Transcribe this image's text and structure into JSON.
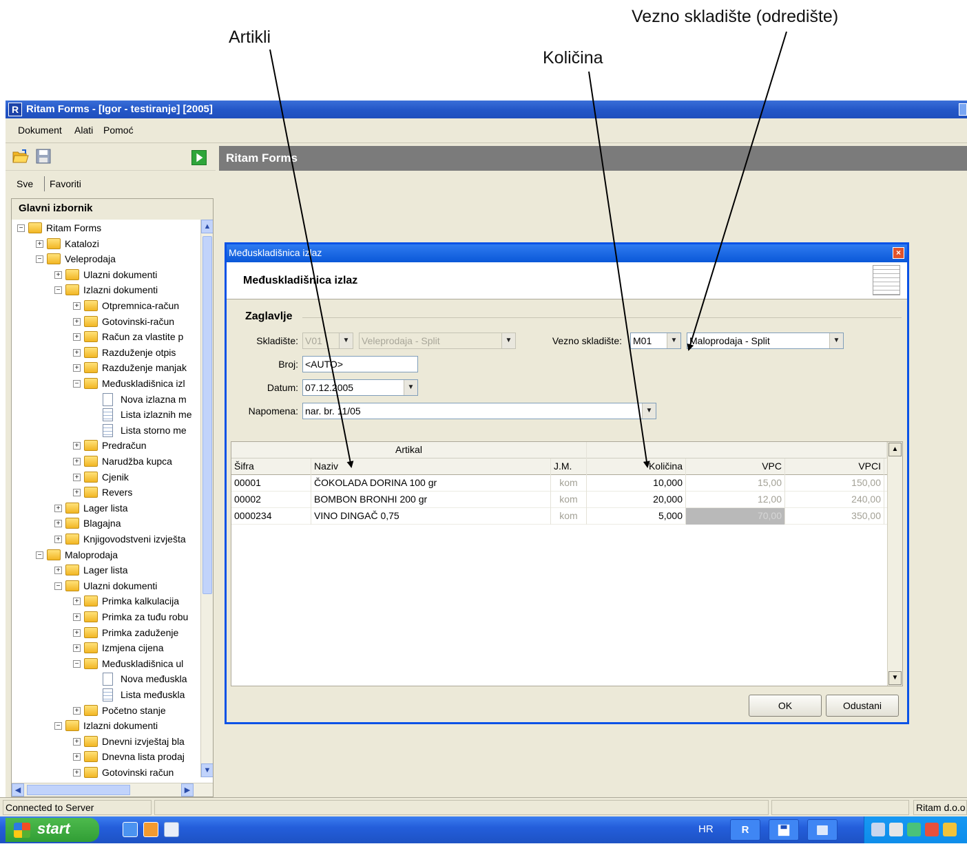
{
  "annotations": {
    "artikli": "Artikli",
    "kolicina": "Količina",
    "vezno": "Vezno skladište (odredište)"
  },
  "window": {
    "title": "Ritam Forms - [Igor - testiranje] [2005]",
    "logo_letter": "R"
  },
  "menu": [
    "Dokument",
    "Alati",
    "Pomoć"
  ],
  "left_panel": {
    "tabs": [
      "Sve",
      "Favoriti"
    ],
    "tree_title": "Glavni izbornik",
    "tree": [
      {
        "label": "Ritam Forms",
        "level": 0,
        "expander": "−",
        "icon": "folder"
      },
      {
        "label": "Katalozi",
        "level": 1,
        "expander": "+",
        "icon": "folder"
      },
      {
        "label": "Veleprodaja",
        "level": 1,
        "expander": "−",
        "icon": "folder"
      },
      {
        "label": "Ulazni dokumenti",
        "level": 2,
        "expander": "+",
        "icon": "folder"
      },
      {
        "label": "Izlazni dokumenti",
        "level": 2,
        "expander": "−",
        "icon": "folder"
      },
      {
        "label": "Otpremnica-račun",
        "level": 3,
        "expander": "+",
        "icon": "folder"
      },
      {
        "label": "Gotovinski-račun",
        "level": 3,
        "expander": "+",
        "icon": "folder"
      },
      {
        "label": "Račun za vlastite p",
        "level": 3,
        "expander": "+",
        "icon": "folder"
      },
      {
        "label": "Razduženje otpis",
        "level": 3,
        "expander": "+",
        "icon": "folder"
      },
      {
        "label": "Razduženje manjak",
        "level": 3,
        "expander": "+",
        "icon": "folder"
      },
      {
        "label": "Međuskladišnica izl",
        "level": 3,
        "expander": "−",
        "icon": "folder"
      },
      {
        "label": "Nova izlazna m",
        "level": 4,
        "expander": "",
        "icon": "doc"
      },
      {
        "label": "Lista izlaznih me",
        "level": 4,
        "expander": "",
        "icon": "doc-lines"
      },
      {
        "label": "Lista storno me",
        "level": 4,
        "expander": "",
        "icon": "doc-lines"
      },
      {
        "label": "Predračun",
        "level": 3,
        "expander": "+",
        "icon": "folder"
      },
      {
        "label": "Narudžba kupca",
        "level": 3,
        "expander": "+",
        "icon": "folder"
      },
      {
        "label": "Cjenik",
        "level": 3,
        "expander": "+",
        "icon": "folder"
      },
      {
        "label": "Revers",
        "level": 3,
        "expander": "+",
        "icon": "folder"
      },
      {
        "label": "Lager lista",
        "level": 2,
        "expander": "+",
        "icon": "folder"
      },
      {
        "label": "Blagajna",
        "level": 2,
        "expander": "+",
        "icon": "folder"
      },
      {
        "label": "Knjigovodstveni izvješta",
        "level": 2,
        "expander": "+",
        "icon": "folder"
      },
      {
        "label": "Maloprodaja",
        "level": 1,
        "expander": "−",
        "icon": "folder"
      },
      {
        "label": "Lager lista",
        "level": 2,
        "expander": "+",
        "icon": "folder"
      },
      {
        "label": "Ulazni dokumenti",
        "level": 2,
        "expander": "−",
        "icon": "folder"
      },
      {
        "label": "Primka kalkulacija",
        "level": 3,
        "expander": "+",
        "icon": "folder"
      },
      {
        "label": "Primka za tuđu robu",
        "level": 3,
        "expander": "+",
        "icon": "folder"
      },
      {
        "label": "Primka zaduženje",
        "level": 3,
        "expander": "+",
        "icon": "folder"
      },
      {
        "label": "Izmjena cijena",
        "level": 3,
        "expander": "+",
        "icon": "folder"
      },
      {
        "label": "Međuskladišnica ul",
        "level": 3,
        "expander": "−",
        "icon": "folder"
      },
      {
        "label": "Nova međuskla",
        "level": 4,
        "expander": "",
        "icon": "doc"
      },
      {
        "label": "Lista međuskla",
        "level": 4,
        "expander": "",
        "icon": "doc-lines"
      },
      {
        "label": "Početno stanje",
        "level": 3,
        "expander": "+",
        "icon": "folder"
      },
      {
        "label": "Izlazni dokumenti",
        "level": 2,
        "expander": "−",
        "icon": "folder"
      },
      {
        "label": "Dnevni izvještaj bla",
        "level": 3,
        "expander": "+",
        "icon": "folder"
      },
      {
        "label": "Dnevna lista prodaj",
        "level": 3,
        "expander": "+",
        "icon": "folder"
      },
      {
        "label": "Gotovinski račun",
        "level": 3,
        "expander": "+",
        "icon": "folder"
      }
    ]
  },
  "main_header": "Ritam Forms",
  "dialog": {
    "title": "Međuskladišnica izlaz",
    "header_title": "Međuskladišnica izlaz",
    "section": "Zaglavlje",
    "fields": {
      "skladiste_label": "Skladište:",
      "skladiste_code": "V01",
      "skladiste_name": "Veleprodaja - Split",
      "vezno_label": "Vezno skladište:",
      "vezno_code": "M01",
      "vezno_name": "Maloprodaja - Split",
      "broj_label": "Broj:",
      "broj_value": "<AUTO>",
      "datum_label": "Datum:",
      "datum_value": "07.12.2005",
      "napomena_label": "Napomena:",
      "napomena_value": "nar. br. 11/05"
    },
    "grid": {
      "group_header": "Artikal",
      "columns": [
        "Šifra",
        "Naziv",
        "J.M.",
        "Količina",
        "VPC",
        "VPCI"
      ],
      "rows": [
        {
          "sifra": "00001",
          "naziv": "ČOKOLADA DORINA 100 gr",
          "jm": "kom",
          "kolicina": "10,000",
          "vpc": "15,00",
          "vpci": "150,00"
        },
        {
          "sifra": "00002",
          "naziv": "BOMBON BRONHI 200 gr",
          "jm": "kom",
          "kolicina": "20,000",
          "vpc": "12,00",
          "vpci": "240,00"
        },
        {
          "sifra": "0000234",
          "naziv": "VINO DINGAČ 0,75",
          "jm": "kom",
          "kolicina": "5,000",
          "vpc": "70,00",
          "vpci": "350,00"
        }
      ]
    },
    "ok": "OK",
    "cancel": "Odustani"
  },
  "status": {
    "left": "Connected to Server",
    "right": "Ritam d.o.o."
  },
  "taskbar": {
    "start": "start",
    "lang": "HR",
    "ritam_btn": "R"
  }
}
